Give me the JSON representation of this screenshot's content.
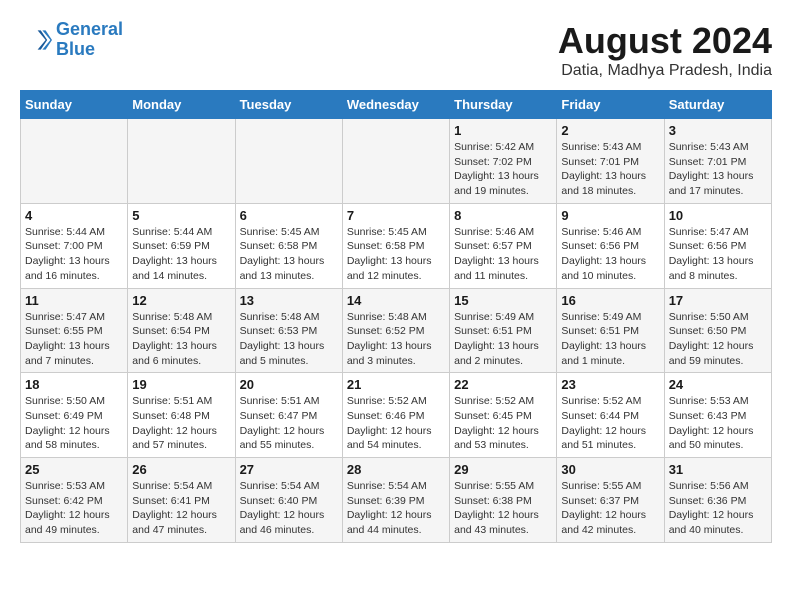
{
  "logo": {
    "line1": "General",
    "line2": "Blue"
  },
  "title": "August 2024",
  "subtitle": "Datia, Madhya Pradesh, India",
  "days_of_week": [
    "Sunday",
    "Monday",
    "Tuesday",
    "Wednesday",
    "Thursday",
    "Friday",
    "Saturday"
  ],
  "weeks": [
    [
      {
        "day": "",
        "detail": ""
      },
      {
        "day": "",
        "detail": ""
      },
      {
        "day": "",
        "detail": ""
      },
      {
        "day": "",
        "detail": ""
      },
      {
        "day": "1",
        "detail": "Sunrise: 5:42 AM\nSunset: 7:02 PM\nDaylight: 13 hours\nand 19 minutes."
      },
      {
        "day": "2",
        "detail": "Sunrise: 5:43 AM\nSunset: 7:01 PM\nDaylight: 13 hours\nand 18 minutes."
      },
      {
        "day": "3",
        "detail": "Sunrise: 5:43 AM\nSunset: 7:01 PM\nDaylight: 13 hours\nand 17 minutes."
      }
    ],
    [
      {
        "day": "4",
        "detail": "Sunrise: 5:44 AM\nSunset: 7:00 PM\nDaylight: 13 hours\nand 16 minutes."
      },
      {
        "day": "5",
        "detail": "Sunrise: 5:44 AM\nSunset: 6:59 PM\nDaylight: 13 hours\nand 14 minutes."
      },
      {
        "day": "6",
        "detail": "Sunrise: 5:45 AM\nSunset: 6:58 PM\nDaylight: 13 hours\nand 13 minutes."
      },
      {
        "day": "7",
        "detail": "Sunrise: 5:45 AM\nSunset: 6:58 PM\nDaylight: 13 hours\nand 12 minutes."
      },
      {
        "day": "8",
        "detail": "Sunrise: 5:46 AM\nSunset: 6:57 PM\nDaylight: 13 hours\nand 11 minutes."
      },
      {
        "day": "9",
        "detail": "Sunrise: 5:46 AM\nSunset: 6:56 PM\nDaylight: 13 hours\nand 10 minutes."
      },
      {
        "day": "10",
        "detail": "Sunrise: 5:47 AM\nSunset: 6:56 PM\nDaylight: 13 hours\nand 8 minutes."
      }
    ],
    [
      {
        "day": "11",
        "detail": "Sunrise: 5:47 AM\nSunset: 6:55 PM\nDaylight: 13 hours\nand 7 minutes."
      },
      {
        "day": "12",
        "detail": "Sunrise: 5:48 AM\nSunset: 6:54 PM\nDaylight: 13 hours\nand 6 minutes."
      },
      {
        "day": "13",
        "detail": "Sunrise: 5:48 AM\nSunset: 6:53 PM\nDaylight: 13 hours\nand 5 minutes."
      },
      {
        "day": "14",
        "detail": "Sunrise: 5:48 AM\nSunset: 6:52 PM\nDaylight: 13 hours\nand 3 minutes."
      },
      {
        "day": "15",
        "detail": "Sunrise: 5:49 AM\nSunset: 6:51 PM\nDaylight: 13 hours\nand 2 minutes."
      },
      {
        "day": "16",
        "detail": "Sunrise: 5:49 AM\nSunset: 6:51 PM\nDaylight: 13 hours\nand 1 minute."
      },
      {
        "day": "17",
        "detail": "Sunrise: 5:50 AM\nSunset: 6:50 PM\nDaylight: 12 hours\nand 59 minutes."
      }
    ],
    [
      {
        "day": "18",
        "detail": "Sunrise: 5:50 AM\nSunset: 6:49 PM\nDaylight: 12 hours\nand 58 minutes."
      },
      {
        "day": "19",
        "detail": "Sunrise: 5:51 AM\nSunset: 6:48 PM\nDaylight: 12 hours\nand 57 minutes."
      },
      {
        "day": "20",
        "detail": "Sunrise: 5:51 AM\nSunset: 6:47 PM\nDaylight: 12 hours\nand 55 minutes."
      },
      {
        "day": "21",
        "detail": "Sunrise: 5:52 AM\nSunset: 6:46 PM\nDaylight: 12 hours\nand 54 minutes."
      },
      {
        "day": "22",
        "detail": "Sunrise: 5:52 AM\nSunset: 6:45 PM\nDaylight: 12 hours\nand 53 minutes."
      },
      {
        "day": "23",
        "detail": "Sunrise: 5:52 AM\nSunset: 6:44 PM\nDaylight: 12 hours\nand 51 minutes."
      },
      {
        "day": "24",
        "detail": "Sunrise: 5:53 AM\nSunset: 6:43 PM\nDaylight: 12 hours\nand 50 minutes."
      }
    ],
    [
      {
        "day": "25",
        "detail": "Sunrise: 5:53 AM\nSunset: 6:42 PM\nDaylight: 12 hours\nand 49 minutes."
      },
      {
        "day": "26",
        "detail": "Sunrise: 5:54 AM\nSunset: 6:41 PM\nDaylight: 12 hours\nand 47 minutes."
      },
      {
        "day": "27",
        "detail": "Sunrise: 5:54 AM\nSunset: 6:40 PM\nDaylight: 12 hours\nand 46 minutes."
      },
      {
        "day": "28",
        "detail": "Sunrise: 5:54 AM\nSunset: 6:39 PM\nDaylight: 12 hours\nand 44 minutes."
      },
      {
        "day": "29",
        "detail": "Sunrise: 5:55 AM\nSunset: 6:38 PM\nDaylight: 12 hours\nand 43 minutes."
      },
      {
        "day": "30",
        "detail": "Sunrise: 5:55 AM\nSunset: 6:37 PM\nDaylight: 12 hours\nand 42 minutes."
      },
      {
        "day": "31",
        "detail": "Sunrise: 5:56 AM\nSunset: 6:36 PM\nDaylight: 12 hours\nand 40 minutes."
      }
    ]
  ]
}
